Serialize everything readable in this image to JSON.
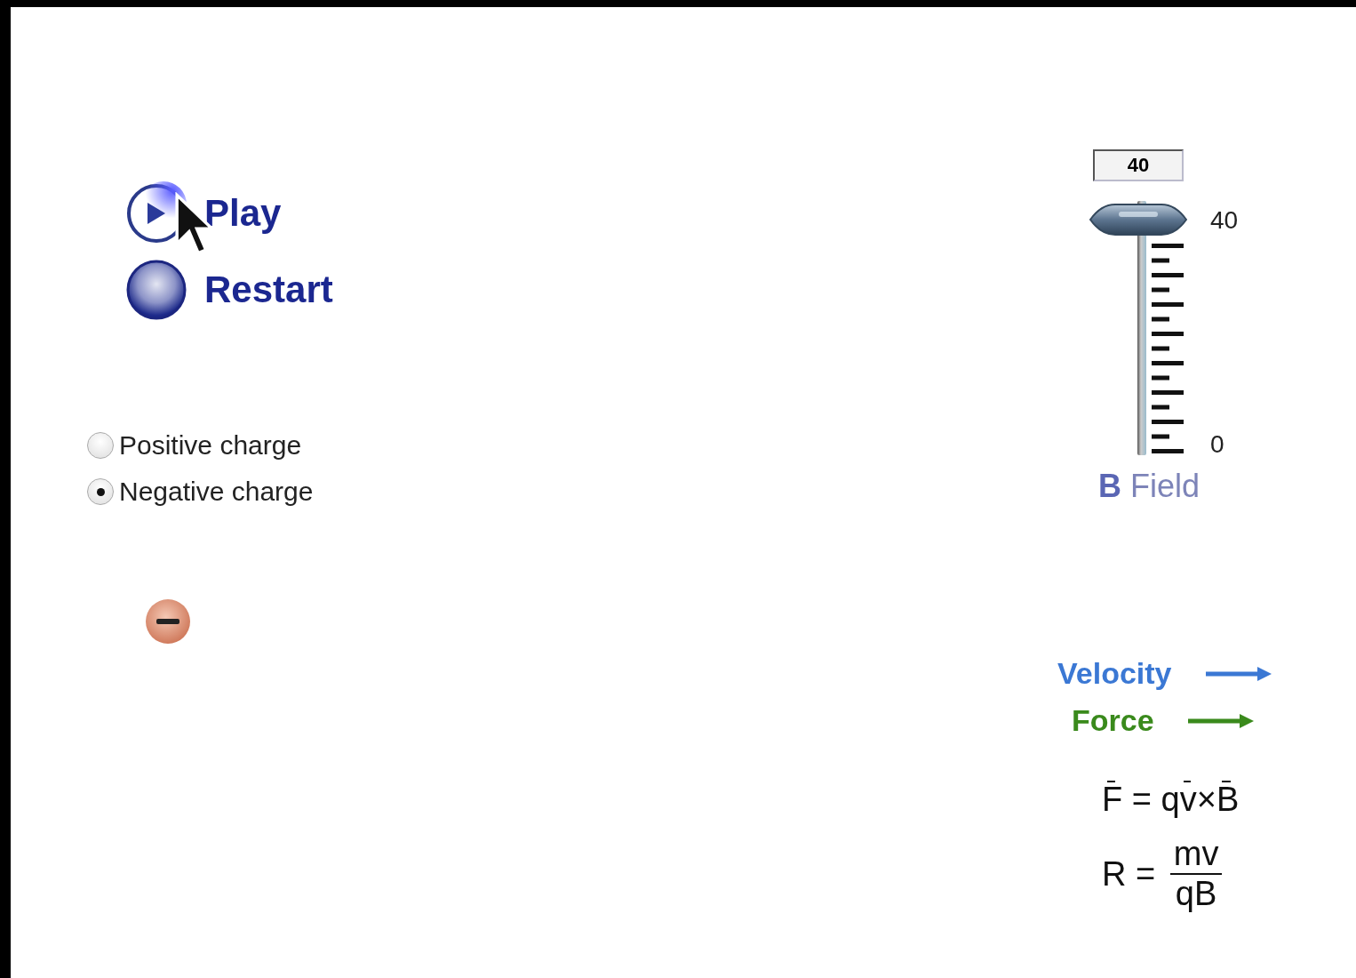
{
  "controls": [
    {
      "kind": "play",
      "label": "Play"
    },
    {
      "kind": "restart",
      "label": "Restart"
    }
  ],
  "charge_options": [
    {
      "label": "Positive charge",
      "selected": false
    },
    {
      "label": "Negative charge",
      "selected": true
    }
  ],
  "particle": {
    "kind": "negative"
  },
  "b_field": {
    "value": "40",
    "max_label": "40",
    "min_label": "0",
    "label": "**B** Field",
    "level": 1
  },
  "legend": [
    {
      "label": "Velocity",
      "color": "#3b78d4"
    },
    {
      "label": "Force",
      "color": "#3a8a1c"
    }
  ],
  "formulas": [
    {
      "kind": "inline",
      "parts": [
        {
          "text": "F",
          "vector": true
        },
        {
          "text": " = q",
          "vector": false
        },
        {
          "text": "v",
          "vector": true
        },
        {
          "text": "×",
          "vector": false
        },
        {
          "text": "B",
          "vector": true
        }
      ]
    },
    {
      "kind": "fraction",
      "lhs": "R = ",
      "numerator": "mv",
      "denominator": "qB"
    }
  ]
}
